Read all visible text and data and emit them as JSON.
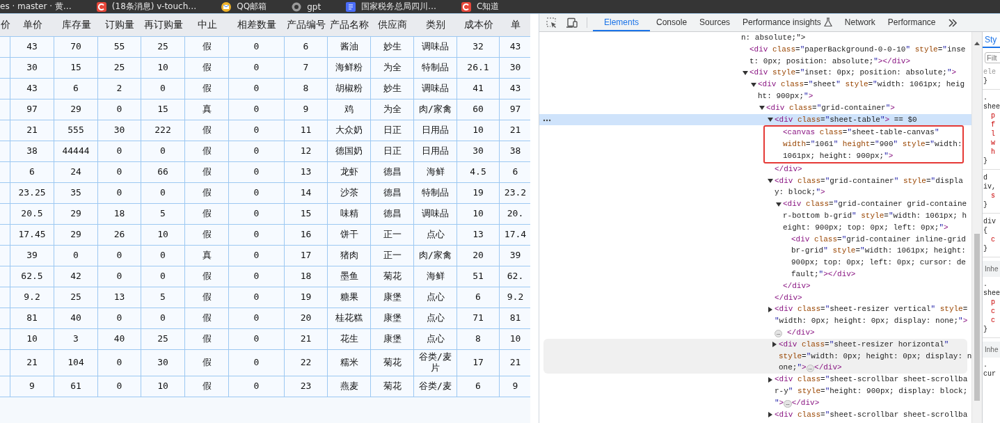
{
  "bookmarks": [
    {
      "label": "es · master · 黄…"
    },
    {
      "label": "(18条消息) v-touch…"
    },
    {
      "label": "QQ邮箱"
    },
    {
      "label": "gpt"
    },
    {
      "label": "国家税务总局四川…"
    },
    {
      "label": "C知道"
    }
  ],
  "sheet": {
    "columns": [
      "价",
      "单价",
      "库存量",
      "订购量",
      "再订购量",
      "中止",
      "相差数量",
      "产品编号",
      "产品名称",
      "供应商",
      "类别",
      "成本价",
      "单"
    ],
    "rows": [
      {
        "cells": [
          "",
          "43",
          "70",
          "55",
          "25",
          "假",
          "0",
          "6",
          "酱油",
          "妙生",
          "调味品",
          "32",
          "43"
        ]
      },
      {
        "cells": [
          "",
          "30",
          "15",
          "25",
          "10",
          "假",
          "0",
          "7",
          "海鲜粉",
          "为全",
          "特制品",
          "26.1",
          "30"
        ]
      },
      {
        "cells": [
          "",
          "43",
          "6",
          "2",
          "0",
          "假",
          "0",
          "8",
          "胡椒粉",
          "妙生",
          "调味品",
          "41",
          "43"
        ]
      },
      {
        "cells": [
          "",
          "97",
          "29",
          "0",
          "15",
          "真",
          "0",
          "9",
          "鸡",
          "为全",
          "肉/家禽",
          "60",
          "97"
        ]
      },
      {
        "cells": [
          "",
          "21",
          "555",
          "30",
          "222",
          "假",
          "0",
          "11",
          "大众奶",
          "日正",
          "日用品",
          "10",
          "21"
        ]
      },
      {
        "cells": [
          "",
          "38",
          "44444",
          "0",
          "0",
          "假",
          "0",
          "12",
          "德国奶",
          "日正",
          "日用品",
          "30",
          "38"
        ]
      },
      {
        "cells": [
          "",
          "6",
          "24",
          "0",
          "66",
          "假",
          "0",
          "13",
          "龙虾",
          "德昌",
          "海鲜",
          "4.5",
          "6"
        ]
      },
      {
        "cells": [
          "",
          "23.25",
          "35",
          "0",
          "0",
          "假",
          "0",
          "14",
          "沙茶",
          "德昌",
          "特制品",
          "19",
          "23.2"
        ]
      },
      {
        "cells": [
          "",
          "20.5",
          "29",
          "18",
          "5",
          "假",
          "0",
          "15",
          "味精",
          "德昌",
          "调味品",
          "10",
          "20."
        ]
      },
      {
        "cells": [
          "",
          "17.45",
          "29",
          "26",
          "10",
          "假",
          "0",
          "16",
          "饼干",
          "正一",
          "点心",
          "13",
          "17.4"
        ]
      },
      {
        "cells": [
          "",
          "39",
          "0",
          "0",
          "0",
          "真",
          "0",
          "17",
          "猪肉",
          "正一",
          "肉/家禽",
          "20",
          "39"
        ]
      },
      {
        "cells": [
          "",
          "62.5",
          "42",
          "0",
          "0",
          "假",
          "0",
          "18",
          "墨鱼",
          "菊花",
          "海鲜",
          "51",
          "62."
        ]
      },
      {
        "cells": [
          "",
          "9.2",
          "25",
          "13",
          "5",
          "假",
          "0",
          "19",
          "糖果",
          "康堡",
          "点心",
          "6",
          "9.2"
        ]
      },
      {
        "cells": [
          "",
          "81",
          "40",
          "0",
          "0",
          "假",
          "0",
          "20",
          "桂花糕",
          "康堡",
          "点心",
          "71",
          "81"
        ]
      },
      {
        "cells": [
          "",
          "10",
          "3",
          "40",
          "25",
          "假",
          "0",
          "21",
          "花生",
          "康堡",
          "点心",
          "8",
          "10"
        ]
      },
      {
        "cells": [
          "",
          "21",
          "104",
          "0",
          "30",
          "假",
          "0",
          "22",
          "糯米",
          "菊花",
          "谷类/麦片",
          "17",
          "21"
        ]
      },
      {
        "cells": [
          "",
          "9",
          "61",
          "0",
          "10",
          "假",
          "0",
          "23",
          "燕麦",
          "菊花",
          "谷类/麦",
          "6",
          "9"
        ]
      }
    ]
  },
  "devtools": {
    "tabs": [
      {
        "label": "Elements",
        "selected": true
      },
      {
        "label": "Console",
        "selected": false
      },
      {
        "label": "Sources",
        "selected": false
      },
      {
        "label": "Performance insights",
        "selected": false
      },
      {
        "label": "Network",
        "selected": false
      },
      {
        "label": "Performance",
        "selected": false
      }
    ],
    "dom_tree": [
      {
        "lines": [
          "n: absolute;\">"
        ],
        "children": [
          {
            "lines": [
              "<div class=\"paperBackground-0-0-10\" style=\"inse",
              "t: 0px; position: absolute;\"></div>"
            ]
          },
          {
            "kind": "open",
            "lines": [
              "<div style=\"inset: 0px; position: absolute;\">"
            ],
            "children": [
              {
                "kind": "open",
                "lines": [
                  "<div class=\"sheet\" style=\"width: 1061px; heig",
                  "ht: 900px;\">"
                ],
                "children": [
                  {
                    "kind": "open",
                    "lines": [
                      "<div class=\"grid-container\">"
                    ],
                    "children": [
                      {
                        "kind": "open",
                        "selected": true,
                        "lines": [
                          "<div class=\"sheet-table\"> == $0"
                        ],
                        "children": [
                          {
                            "annotated": true,
                            "lines": [
                              "<canvas class=\"sheet-table-canvas\"",
                              "width=\"1061\" height=\"900\" style=\"width:",
                              "1061px; height: 900px;\">"
                            ]
                          }
                        ]
                      },
                      {
                        "lines": [
                          "</div>"
                        ]
                      },
                      {
                        "kind": "open",
                        "lines": [
                          "<div class=\"grid-container\" style=\"displa",
                          "y: block;\">"
                        ],
                        "children": [
                          {
                            "kind": "open",
                            "lines": [
                              "<div class=\"grid-container grid-containe",
                              "r-bottom b-grid\" style=\"width: 1061px; h",
                              "eight: 900px; top: 0px; left: 0px;\">"
                            ],
                            "children": [
                              {
                                "lines": [
                                  "<div class=\"grid-container inline-grid",
                                  "br-grid\" style=\"width: 1061px; height:",
                                  "900px; top: 0px; left: 0px; cursor: de",
                                  "fault;\"></div>"
                                ]
                              }
                            ]
                          },
                          {
                            "lines": [
                              "</div>"
                            ]
                          }
                        ]
                      },
                      {
                        "lines": [
                          "</div>"
                        ]
                      },
                      {
                        "kind": "closed",
                        "lines": [
                          "<div class=\"sheet-resizer vertical\" style=",
                          "\"width: 0px; height: 0px; display: none;\">",
                          "… </div>"
                        ]
                      },
                      {
                        "kind": "closed",
                        "hovered": true,
                        "lines": [
                          "<div class=\"sheet-resizer horizontal\"",
                          "style=\"width: 0px; height: 0px; display: n",
                          "one;\">…</div>"
                        ]
                      },
                      {
                        "kind": "closed",
                        "lines": [
                          "<div class=\"sheet-scrollbar sheet-scrollba",
                          "r-y\" style=\"height: 900px; display: block;",
                          "\">…</div>"
                        ]
                      },
                      {
                        "kind": "closed",
                        "lines": [
                          "<div class=\"sheet-scrollbar sheet-scrollba"
                        ]
                      }
                    ]
                  }
                ]
              }
            ]
          }
        ]
      }
    ],
    "styles": {
      "tab": "Sty",
      "filter_placeholder": "Filt",
      "lines": [
        {
          "kind": "muted",
          "text": "ele"
        },
        {
          "kind": "brace",
          "text": "}"
        },
        {
          "kind": "sel",
          "text": "."
        },
        {
          "kind": "sel",
          "text": "shee"
        },
        {
          "kind": "prop",
          "text": "p"
        },
        {
          "kind": "prop",
          "text": "f"
        },
        {
          "kind": "prop",
          "text": "l"
        },
        {
          "kind": "prop",
          "text": "w"
        },
        {
          "kind": "prop",
          "text": "h"
        },
        {
          "kind": "brace",
          "text": "}"
        },
        {
          "kind": "sel",
          "text": "d"
        },
        {
          "kind": "sel",
          "text": "iv,"
        },
        {
          "kind": "prop",
          "text": "s"
        },
        {
          "kind": "brace",
          "text": "}"
        },
        {
          "kind": "sel",
          "text": "div"
        },
        {
          "kind": "sel",
          "text": "{"
        },
        {
          "kind": "prop",
          "text": "c"
        },
        {
          "kind": "brace",
          "text": "}"
        },
        {
          "kind": "header",
          "text": "Inhe"
        },
        {
          "kind": "sel",
          "text": "."
        },
        {
          "kind": "sel",
          "text": "shee"
        },
        {
          "kind": "prop",
          "text": "p"
        },
        {
          "kind": "prop",
          "text": "c"
        },
        {
          "kind": "prop",
          "text": "c"
        },
        {
          "kind": "brace",
          "text": "}"
        },
        {
          "kind": "header",
          "text": "Inhe"
        },
        {
          "kind": "sel",
          "text": "."
        },
        {
          "kind": "sel",
          "text": "cur"
        }
      ]
    }
  }
}
